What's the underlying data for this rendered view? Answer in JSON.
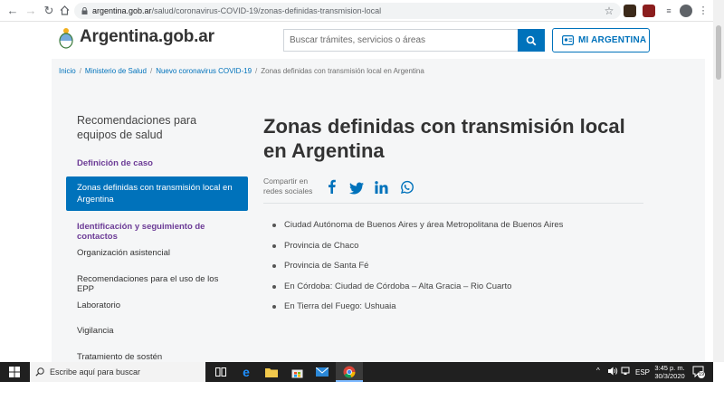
{
  "browser": {
    "url_host": "argentina.gob.ar",
    "url_path": "/salud/coronavirus-COVID-19/zonas-definidas-transmision-local"
  },
  "header": {
    "logo_text": "Argentina.gob.ar",
    "search_placeholder": "Buscar trámites, servicios o áreas",
    "mi_argentina_label": "MI ARGENTINA"
  },
  "breadcrumb": {
    "items": [
      "Inicio",
      "Ministerio de Salud",
      "Nuevo coronavirus COVID-19"
    ],
    "current": "Zonas definidas con transmisión local en Argentina",
    "separator": "/"
  },
  "sidebar": {
    "title": "Recomendaciones para equipos de salud",
    "items": [
      {
        "label": "Definición de caso"
      },
      {
        "label": "Zonas definidas con transmisión local en Argentina"
      },
      {
        "label": "Identificación y seguimiento de contactos"
      },
      {
        "label": "Organización asistencial"
      },
      {
        "label": "Recomendaciones para el uso de los EPP"
      },
      {
        "label": "Laboratorio"
      },
      {
        "label": "Vigilancia"
      },
      {
        "label": "Tratamiento de sostén"
      }
    ]
  },
  "article": {
    "title": "Zonas definidas con transmisión local en Argentina",
    "share_label": "Compartir en redes sociales",
    "bullets": [
      "Ciudad Autónoma de Buenos Aires y área Metropolitana de Buenos Aires",
      "Provincia de Chaco",
      "Provincia de Santa Fé",
      "En Córdoba: Ciudad de Córdoba – Alta Gracia – Rio Cuarto",
      "En Tierra del Fuego: Ushuaia"
    ]
  },
  "taskbar": {
    "search_text": "Escribe aquí para buscar",
    "language": "ESP",
    "time": "3:45 p. m.",
    "date": "30/3/2020",
    "notification_count": "19"
  },
  "colors": {
    "brand_blue": "#0072bb",
    "purple_link": "#6c3b96",
    "content_bg": "#f5f6f7",
    "taskbar_bg": "#202020"
  }
}
